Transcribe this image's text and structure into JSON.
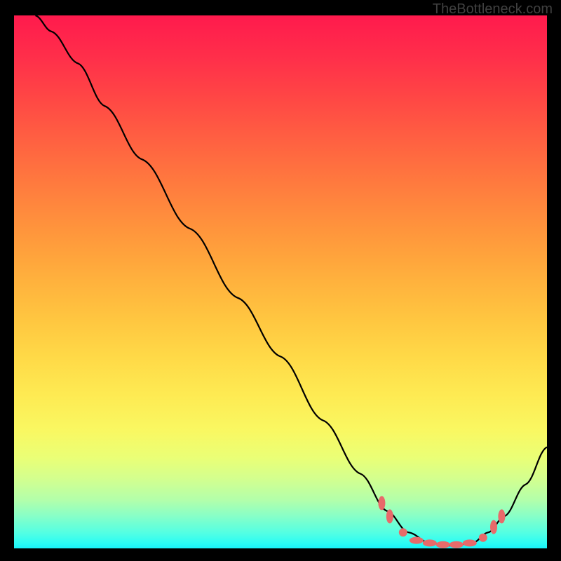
{
  "watermark": "TheBottleneck.com",
  "chart_data": {
    "type": "line",
    "title": "",
    "xlabel": "",
    "ylabel": "",
    "xlim": [
      0,
      100
    ],
    "ylim": [
      0,
      100
    ],
    "curve": [
      {
        "x": 4,
        "y": 100
      },
      {
        "x": 7,
        "y": 97
      },
      {
        "x": 12,
        "y": 91
      },
      {
        "x": 17,
        "y": 83
      },
      {
        "x": 24,
        "y": 73
      },
      {
        "x": 33,
        "y": 60
      },
      {
        "x": 42,
        "y": 47
      },
      {
        "x": 50,
        "y": 36
      },
      {
        "x": 58,
        "y": 24
      },
      {
        "x": 65,
        "y": 14
      },
      {
        "x": 70,
        "y": 7
      },
      {
        "x": 74,
        "y": 3
      },
      {
        "x": 78,
        "y": 1
      },
      {
        "x": 82,
        "y": 0.5
      },
      {
        "x": 86,
        "y": 1
      },
      {
        "x": 89,
        "y": 3
      },
      {
        "x": 92,
        "y": 6
      },
      {
        "x": 96,
        "y": 12
      },
      {
        "x": 100,
        "y": 19
      }
    ],
    "markers": [
      {
        "x": 69,
        "y": 8.5,
        "shape": "tall"
      },
      {
        "x": 70.5,
        "y": 6,
        "shape": "tall"
      },
      {
        "x": 73,
        "y": 3,
        "shape": "round"
      },
      {
        "x": 75.5,
        "y": 1.5,
        "shape": "wide"
      },
      {
        "x": 78,
        "y": 1,
        "shape": "wide"
      },
      {
        "x": 80.5,
        "y": 0.7,
        "shape": "wide"
      },
      {
        "x": 83,
        "y": 0.7,
        "shape": "wide"
      },
      {
        "x": 85.5,
        "y": 1,
        "shape": "wide"
      },
      {
        "x": 88,
        "y": 2,
        "shape": "round"
      },
      {
        "x": 90,
        "y": 4,
        "shape": "tall"
      },
      {
        "x": 91.5,
        "y": 6,
        "shape": "tall"
      }
    ],
    "gradient_stops": [
      {
        "pos": 0,
        "color": "#ff1a4d"
      },
      {
        "pos": 50,
        "color": "#ffb23d"
      },
      {
        "pos": 78,
        "color": "#f9f862"
      },
      {
        "pos": 100,
        "color": "#18f2fa"
      }
    ]
  }
}
